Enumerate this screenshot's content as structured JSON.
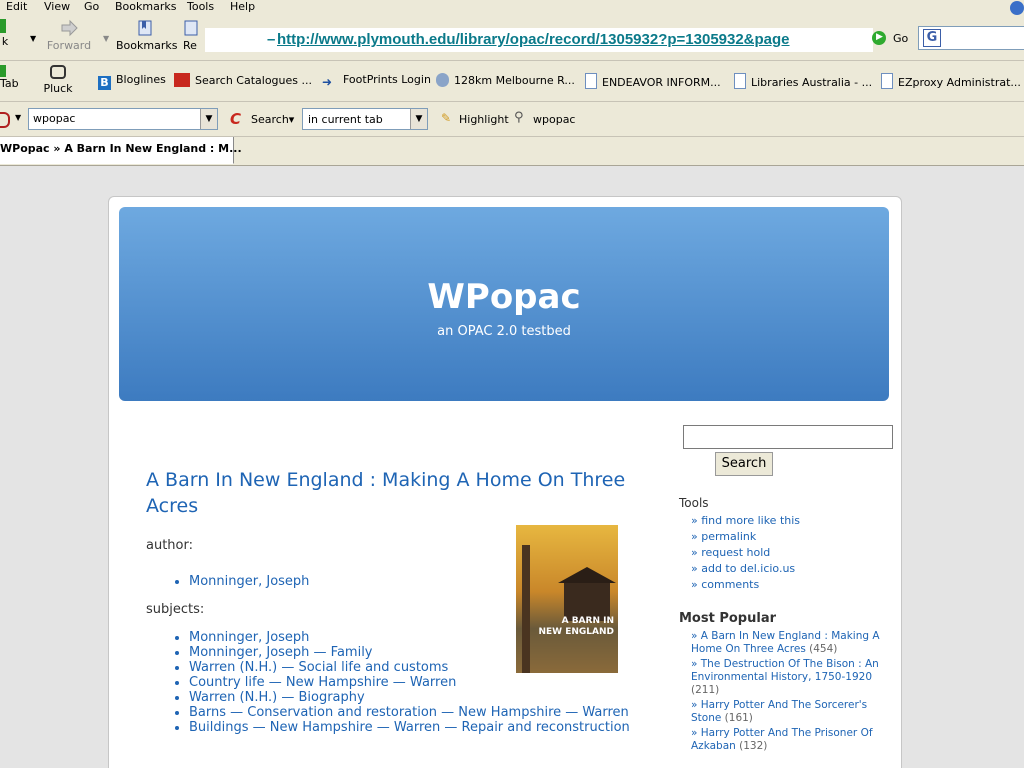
{
  "menu": {
    "items": [
      "Edit",
      "View",
      "Go",
      "Bookmarks",
      "Tools",
      "Help"
    ]
  },
  "nav": {
    "back_label": "k",
    "forward_label": "Forward",
    "bookmarks_label": "Bookmarks",
    "reload_label": "Re",
    "url": "http://www.plymouth.edu/library/opac/record/1305932?p=1305932&page",
    "url_prefix": "–",
    "go_label": "Go"
  },
  "bookmarks_bar": {
    "tab_label": "Tab",
    "pluck_label": "Pluck",
    "items": [
      "Bloglines",
      "Search Catalogues ...",
      "FootPrints Login",
      "128km Melbourne R...",
      "ENDEAVOR INFORM...",
      "Libraries Australia - ...",
      "EZproxy Administrat..."
    ]
  },
  "search_toolbar": {
    "query": "wpopac",
    "search_label": "Search",
    "target_select": "in current tab",
    "highlight_label": "Highlight",
    "term_label": "wpopac"
  },
  "tab": {
    "title": "WPopac » A Barn In New England : M..."
  },
  "site": {
    "title": "WPopac",
    "tagline": "an OPAC 2.0 testbed"
  },
  "record": {
    "title": "A Barn In New England : Making A Home On Three Acres",
    "author_label": "author:",
    "authors": [
      "Monninger, Joseph"
    ],
    "subjects_label": "subjects:",
    "subjects": [
      "Monninger, Joseph",
      "Monninger, Joseph — Family",
      "Warren (N.H.) — Social life and customs",
      "Country life — New Hampshire — Warren",
      "Warren (N.H.) — Biography",
      "Barns — Conservation and restoration — New Hampshire — Warren",
      "Buildings — New Hampshire — Warren — Repair and reconstruction"
    ],
    "cover": {
      "line1": "A BARN IN",
      "line2": "NEW ENGLAND"
    }
  },
  "sidebar": {
    "search_button": "Search",
    "tools_heading": "Tools",
    "tools": [
      "» find more like this",
      "» permalink",
      "» request hold",
      "» add to del.icio.us",
      "» comments"
    ],
    "popular_heading": "Most Popular",
    "popular": [
      {
        "title": "» A Barn In New England : Making A Home On Three Acres",
        "count": "(454)"
      },
      {
        "title": "» The Destruction Of The Bison : An Environmental History, 1750-1920",
        "count": "(211)"
      },
      {
        "title": "» Harry Potter And The Sorcerer's Stone",
        "count": "(161)"
      },
      {
        "title": "» Harry Potter And The Prisoner Of Azkaban",
        "count": "(132)"
      }
    ]
  },
  "colors": {
    "link": "#1e64b4",
    "header_top": "#6ea9e0",
    "header_bottom": "#3d7bc0",
    "url_text": "#0b7a8a"
  }
}
